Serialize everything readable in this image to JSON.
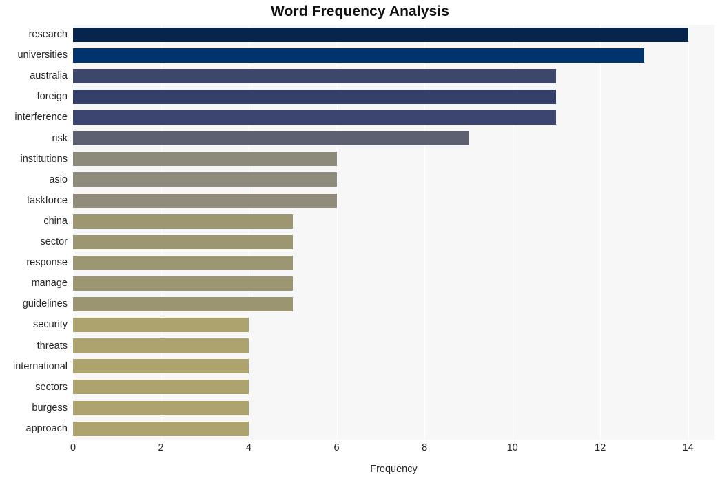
{
  "chart_data": {
    "type": "bar",
    "orientation": "horizontal",
    "title": "Word Frequency Analysis",
    "xlabel": "Frequency",
    "ylabel": "",
    "xlim": [
      0,
      14.6
    ],
    "xticks": [
      0,
      2,
      4,
      6,
      8,
      10,
      12,
      14
    ],
    "grid": true,
    "grid_axis": "x",
    "legend": false,
    "categories": [
      "research",
      "universities",
      "australia",
      "foreign",
      "interference",
      "risk",
      "institutions",
      "asio",
      "taskforce",
      "china",
      "sector",
      "response",
      "manage",
      "guidelines",
      "security",
      "threats",
      "international",
      "sectors",
      "burgess",
      "approach"
    ],
    "values": [
      14,
      13,
      11,
      11,
      11,
      9,
      6,
      6,
      6,
      5,
      5,
      5,
      5,
      5,
      4,
      4,
      4,
      4,
      4,
      4
    ],
    "bar_colors": [
      "#06244c",
      "#00346f",
      "#3d4769",
      "#35406a",
      "#3c4570",
      "#5b5f70",
      "#8e8a7b",
      "#908c7d",
      "#908b7a",
      "#9d9673",
      "#9d9673",
      "#9d9673",
      "#9d9673",
      "#9c9572",
      "#aca36e",
      "#aca36e",
      "#aca36e",
      "#aca36e",
      "#aca36e",
      "#aca36e"
    ],
    "plot_background": "#f7f7f7",
    "figure_background": "#ffffff",
    "gridline_color": "#ffffff"
  }
}
